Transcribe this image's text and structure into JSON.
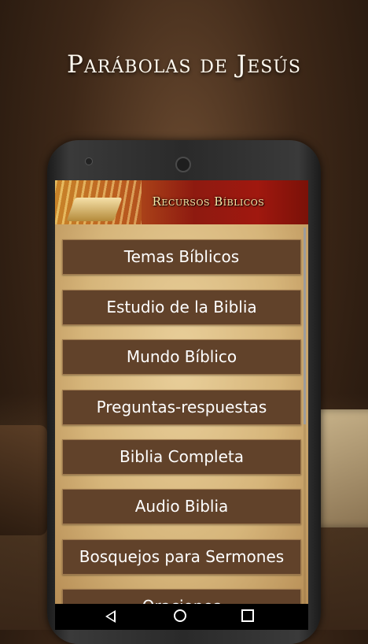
{
  "headline": "Parábolas de Jesús",
  "app": {
    "banner_title": "Recursos Bíblicos"
  },
  "menu": [
    {
      "label": "Temas Bíblicos"
    },
    {
      "label": "Estudio de la Biblia"
    },
    {
      "label": "Mundo Bíblico"
    },
    {
      "label": "Preguntas-respuestas"
    },
    {
      "label": "Biblia Completa"
    },
    {
      "label": "Audio Biblia"
    },
    {
      "label": "Bosquejos para Sermones"
    },
    {
      "label": "Oraciones"
    }
  ],
  "navbar": {
    "back_icon": "back-triangle-icon",
    "home_icon": "home-circle-icon",
    "recent_icon": "recent-apps-square-icon"
  },
  "colors": {
    "button_bg": "#61422a",
    "banner_red": "#8e1a10",
    "parchment": "#e9cf9a"
  }
}
